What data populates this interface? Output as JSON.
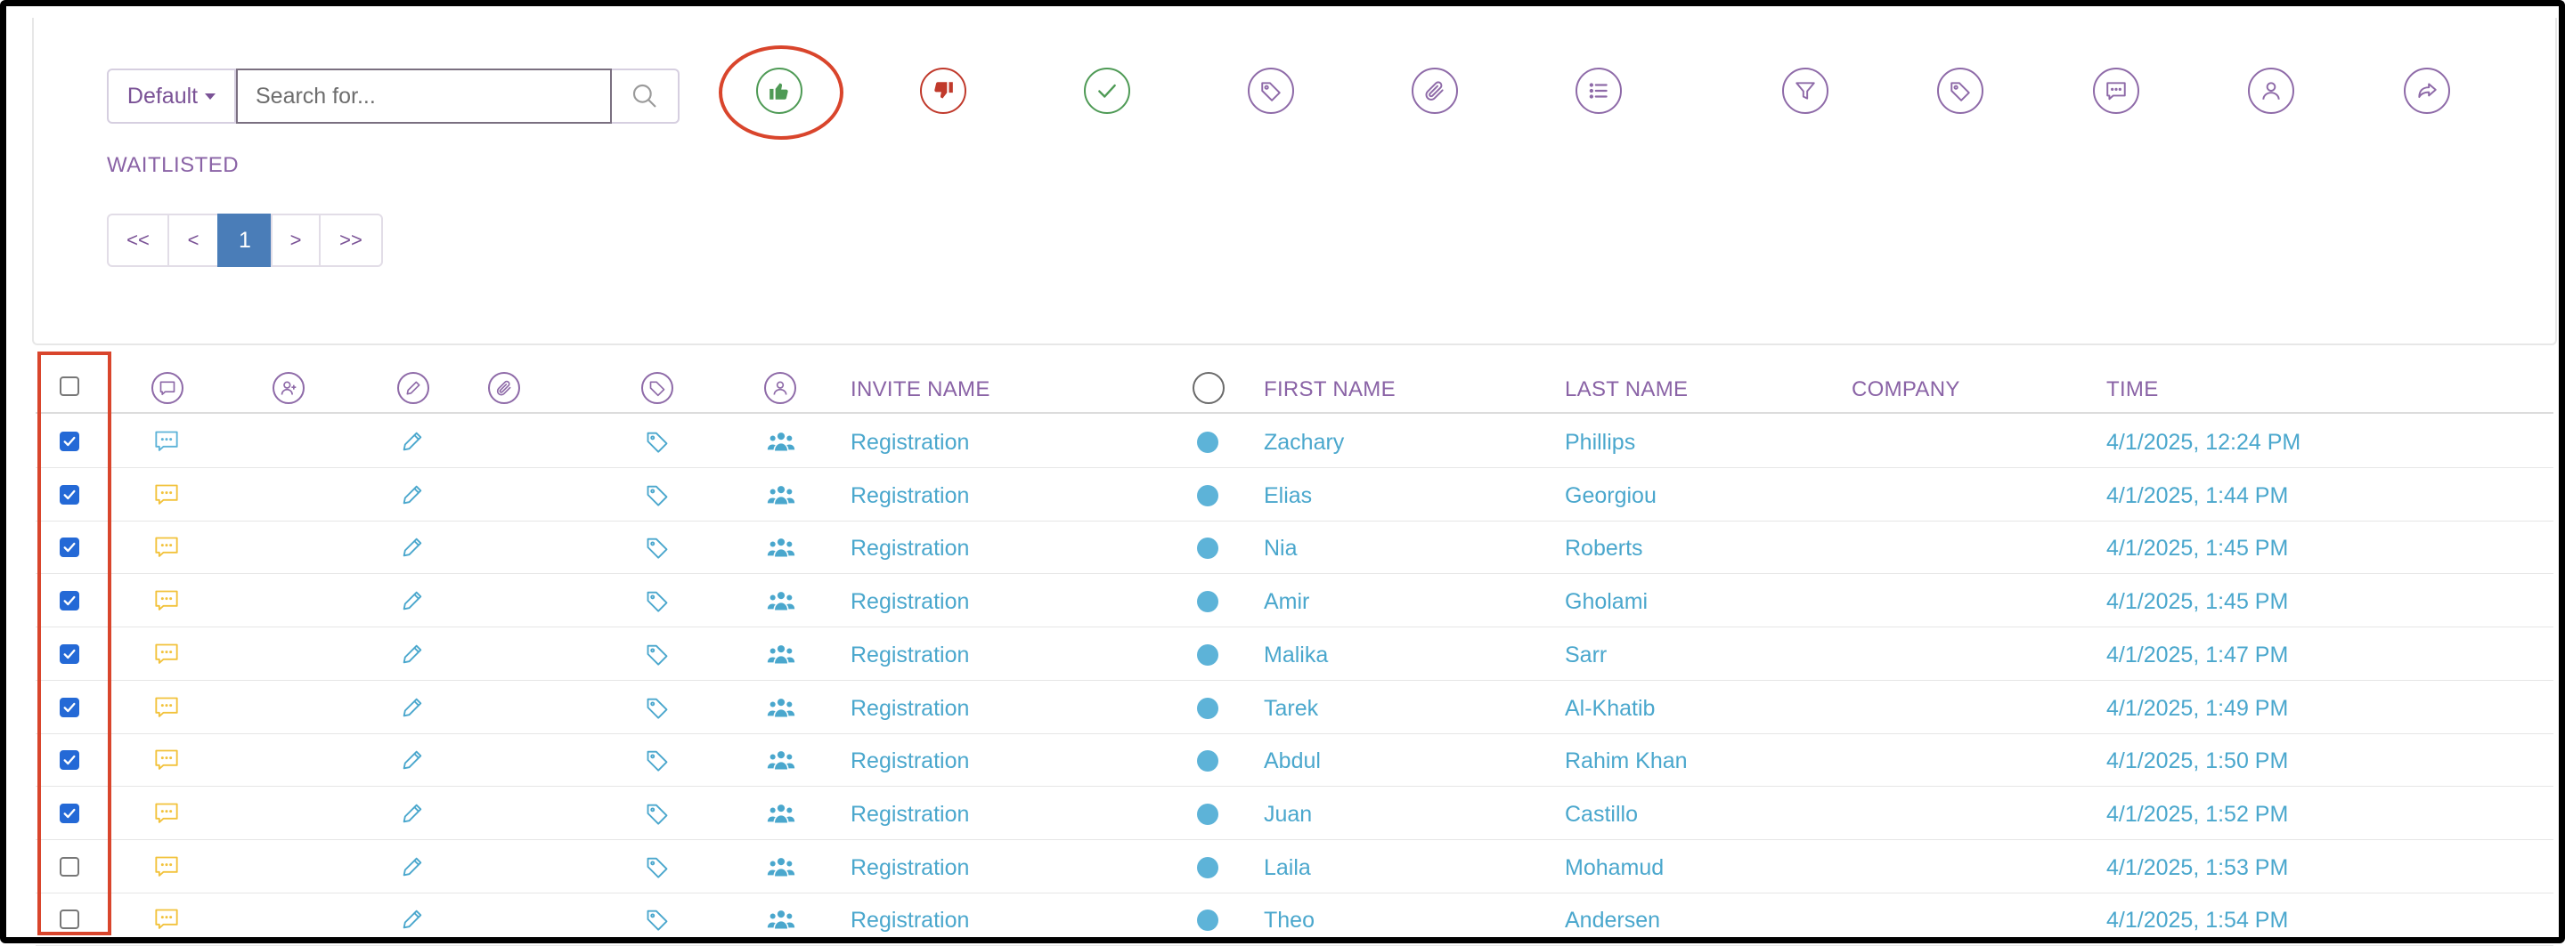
{
  "search": {
    "dropdown_label": "Default",
    "placeholder": "Search for...",
    "value": ""
  },
  "toolbar": [
    {
      "name": "approve-icon",
      "color": "#4e9a55"
    },
    {
      "name": "reject-icon",
      "color": "#c0392b"
    },
    {
      "name": "check-icon",
      "color": "#4e9a55"
    },
    {
      "name": "tag-icon",
      "color": "#8e6aa8"
    },
    {
      "name": "paperclip-icon",
      "color": "#8e6aa8"
    },
    {
      "name": "list-icon",
      "color": "#8e6aa8"
    },
    {
      "name": "filter-icon",
      "color": "#8e6aa8"
    },
    {
      "name": "tags-icon",
      "color": "#8e6aa8"
    },
    {
      "name": "message-icon",
      "color": "#8e6aa8"
    },
    {
      "name": "user-icon",
      "color": "#8e6aa8"
    },
    {
      "name": "share-icon",
      "color": "#8e6aa8"
    }
  ],
  "status_label": "WAITLISTED",
  "pagination": {
    "first": "<<",
    "prev": "<",
    "current": "1",
    "next": ">",
    "last": ">>"
  },
  "table": {
    "headers": {
      "invite_name": "INVITE NAME",
      "first_name": "FIRST NAME",
      "last_name": "LAST NAME",
      "company": "COMPANY",
      "time": "TIME"
    },
    "rows": [
      {
        "checked": true,
        "message_color": "#5db3d8",
        "invite": "Registration",
        "first": "Zachary",
        "last": "Phillips",
        "company": "",
        "time": "4/1/2025, 12:24 PM"
      },
      {
        "checked": true,
        "message_color": "#f2c23b",
        "invite": "Registration",
        "first": "Elias",
        "last": "Georgiou",
        "company": "",
        "time": "4/1/2025, 1:44 PM"
      },
      {
        "checked": true,
        "message_color": "#f2c23b",
        "invite": "Registration",
        "first": "Nia",
        "last": "Roberts",
        "company": "",
        "time": "4/1/2025, 1:45 PM"
      },
      {
        "checked": true,
        "message_color": "#f2c23b",
        "invite": "Registration",
        "first": "Amir",
        "last": "Gholami",
        "company": "",
        "time": "4/1/2025, 1:45 PM"
      },
      {
        "checked": true,
        "message_color": "#f2c23b",
        "invite": "Registration",
        "first": "Malika",
        "last": "Sarr",
        "company": "",
        "time": "4/1/2025, 1:47 PM"
      },
      {
        "checked": true,
        "message_color": "#f2c23b",
        "invite": "Registration",
        "first": "Tarek",
        "last": "Al-Khatib",
        "company": "",
        "time": "4/1/2025, 1:49 PM"
      },
      {
        "checked": true,
        "message_color": "#f2c23b",
        "invite": "Registration",
        "first": "Abdul",
        "last": "Rahim Khan",
        "company": "",
        "time": "4/1/2025, 1:50 PM"
      },
      {
        "checked": true,
        "message_color": "#f2c23b",
        "invite": "Registration",
        "first": "Juan",
        "last": "Castillo",
        "company": "",
        "time": "4/1/2025, 1:52 PM"
      },
      {
        "checked": false,
        "message_color": "#f2c23b",
        "invite": "Registration",
        "first": "Laila",
        "last": "Mohamud",
        "company": "",
        "time": "4/1/2025, 1:53 PM"
      },
      {
        "checked": false,
        "message_color": "#f2c23b",
        "invite": "Registration",
        "first": "Theo",
        "last": "Andersen",
        "company": "",
        "time": "4/1/2025, 1:54 PM"
      }
    ]
  },
  "colors": {
    "accent": "#8a63a6",
    "link": "#4aa7cd",
    "highlight": "#d9452c",
    "checkbox": "#2469d6"
  }
}
